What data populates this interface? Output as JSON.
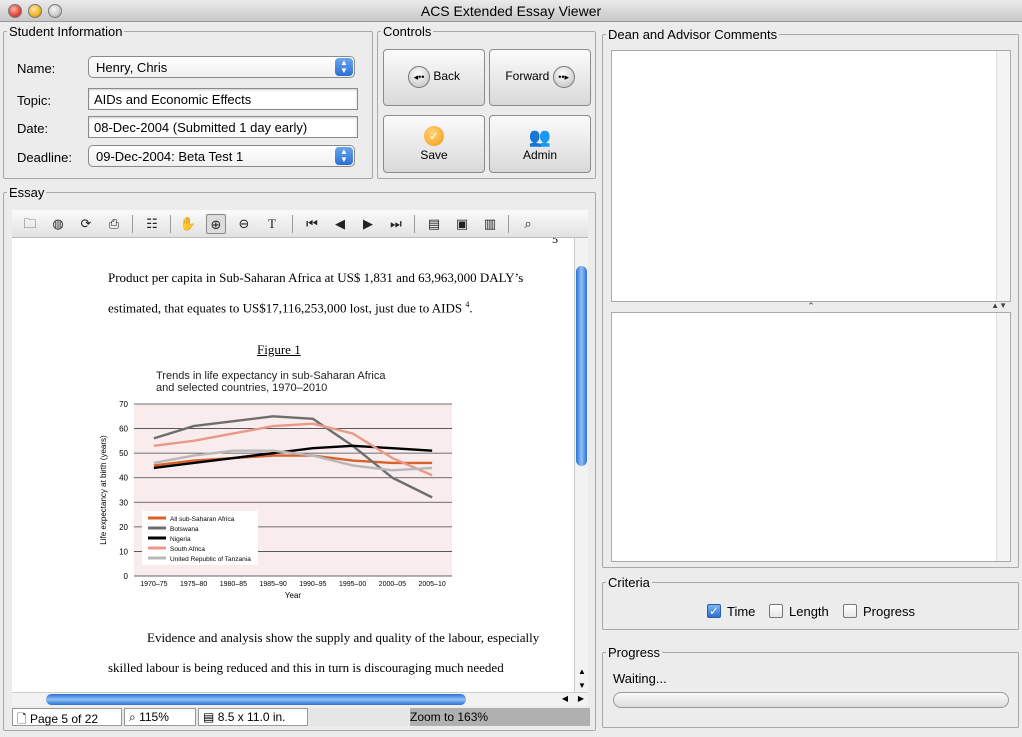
{
  "window": {
    "title": "ACS Extended Essay Viewer"
  },
  "student_info": {
    "legend": "Student Information",
    "name_label": "Name:",
    "name_value": "Henry, Chris",
    "topic_label": "Topic:",
    "topic_value": "AIDs and Economic Effects",
    "date_label": "Date:",
    "date_value": "08-Dec-2004  (Submitted 1 day early)",
    "deadline_label": "Deadline:",
    "deadline_value": "09-Dec-2004: Beta Test 1"
  },
  "controls": {
    "legend": "Controls",
    "back": "Back",
    "forward": "Forward",
    "save": "Save",
    "admin": "Admin"
  },
  "comments": {
    "legend": "Dean and Advisor Comments"
  },
  "essay": {
    "legend": "Essay",
    "page_corner": "5",
    "para1_line1": "Product per capita in Sub-Saharan Africa at US$ 1,831 and 63,963,000 DALY’s",
    "para1_line2": "estimated, that equates to US$17,116,253,000 lost, just due to AIDS",
    "para1_sup": "4",
    "para1_end": ".",
    "figure_caption": "Figure 1",
    "para2_line1": "Evidence and analysis show the supply and quality of the labour, especially",
    "para2_line2": "skilled labour is being reduced and this in turn is discouraging much needed",
    "status": {
      "page": "Page 5 of 22",
      "zoom": "115%",
      "size": "8.5 x 11.0 in.",
      "hint": "Zoom to 163%"
    }
  },
  "criteria": {
    "legend": "Criteria",
    "time": {
      "label": "Time",
      "checked": true
    },
    "length": {
      "label": "Length",
      "checked": false
    },
    "progress": {
      "label": "Progress",
      "checked": false
    }
  },
  "progress": {
    "legend": "Progress",
    "status": "Waiting...",
    "fraction": 0
  },
  "chart_data": {
    "type": "line",
    "title": "Trends in life expectancy in sub-Saharan Africa and selected countries, 1970–2010",
    "xlabel": "Year",
    "ylabel": "Life expectancy at birth (years)",
    "categories": [
      "1970–75",
      "1975–80",
      "1980–85",
      "1985–90",
      "1990–95",
      "1995–00",
      "2000–05",
      "2005–10"
    ],
    "ylim": [
      0,
      70
    ],
    "yticks": [
      0,
      10,
      20,
      30,
      40,
      50,
      60,
      70
    ],
    "legend_position": "bottom-left",
    "series": [
      {
        "name": "All sub-Saharan Africa",
        "color": "#d9622b",
        "values": [
          45,
          47,
          48,
          49,
          49,
          47,
          46,
          46
        ]
      },
      {
        "name": "Botswana",
        "color": "#6e6e6e",
        "values": [
          56,
          61,
          63,
          65,
          64,
          53,
          40,
          32
        ]
      },
      {
        "name": "Nigeria",
        "color": "#000000",
        "values": [
          44,
          46,
          48,
          50,
          52,
          53,
          52,
          51
        ]
      },
      {
        "name": "South Africa",
        "color": "#e8998a",
        "values": [
          53,
          55,
          58,
          61,
          62,
          58,
          48,
          41
        ]
      },
      {
        "name": "United Republic of Tanzania",
        "color": "#b8b8b8",
        "values": [
          46,
          49,
          51,
          51,
          49,
          45,
          43,
          44
        ]
      }
    ]
  }
}
